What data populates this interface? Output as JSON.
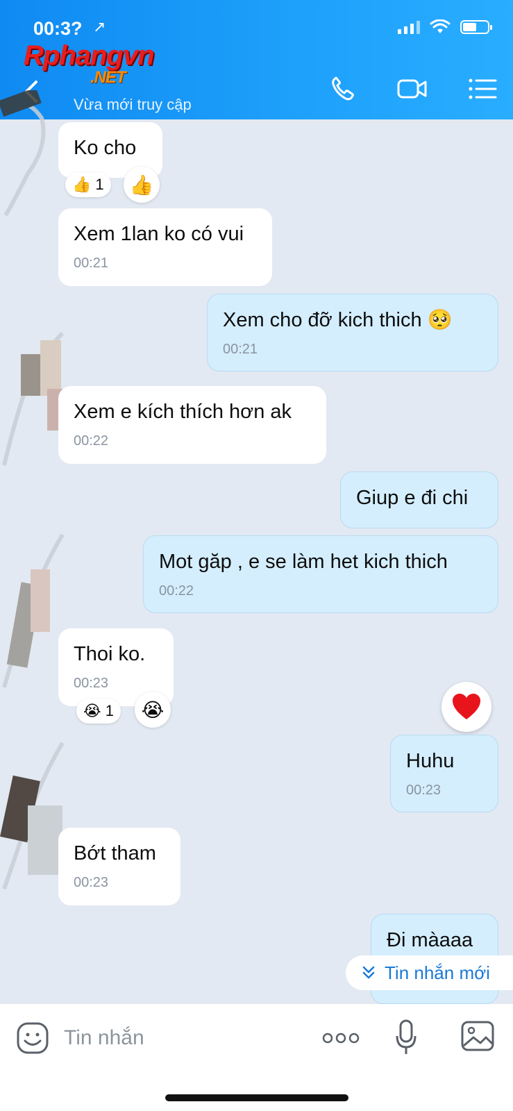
{
  "status_bar": {
    "time": "00:3?",
    "location_glyph": "↗"
  },
  "watermark": {
    "main": "Rphangvn",
    "suffix": ".NET"
  },
  "header": {
    "contact_name": "",
    "contact_status": "Vừa mới truy cập",
    "icons": [
      "back-icon",
      "phone-icon",
      "video-call-icon",
      "menu-icon"
    ]
  },
  "messages": [
    {
      "dir": "in",
      "text": "Ko cho",
      "time": "",
      "reaction": {
        "emoji": "👍",
        "count": "1"
      }
    },
    {
      "dir": "in",
      "text": "Xem 1lan ko có vui",
      "time": "00:21"
    },
    {
      "dir": "out",
      "text": "Xem cho đỡ kich thich 🥺",
      "time": "00:21"
    },
    {
      "dir": "in",
      "text": "Xem e kích thích hơn ak",
      "time": "00:22"
    },
    {
      "dir": "out",
      "text": "Giup e đi chi",
      "time": ""
    },
    {
      "dir": "out",
      "text": "Mot găp , e se làm het kich thich",
      "time": "00:22"
    },
    {
      "dir": "in",
      "text": "Thoi ko.",
      "time": "00:23",
      "reaction": {
        "emoji": "😭",
        "count": "1"
      }
    },
    {
      "dir": "out",
      "text": "Huhu",
      "time": "00:23"
    },
    {
      "dir": "in",
      "text": "Bớt tham",
      "time": "00:23"
    },
    {
      "dir": "out",
      "text": "Đi màaaa",
      "time": ""
    }
  ],
  "heart_reaction": "❤",
  "new_message_button": "Tin nhắn mới",
  "input_bar": {
    "placeholder": "Tin nhắn"
  },
  "colors": {
    "header": "#1a96f6",
    "chat_bg": "#e2e9f2",
    "bubble_in": "#ffffff",
    "bubble_out": "#d4eefe",
    "accent": "#1a79d8"
  }
}
